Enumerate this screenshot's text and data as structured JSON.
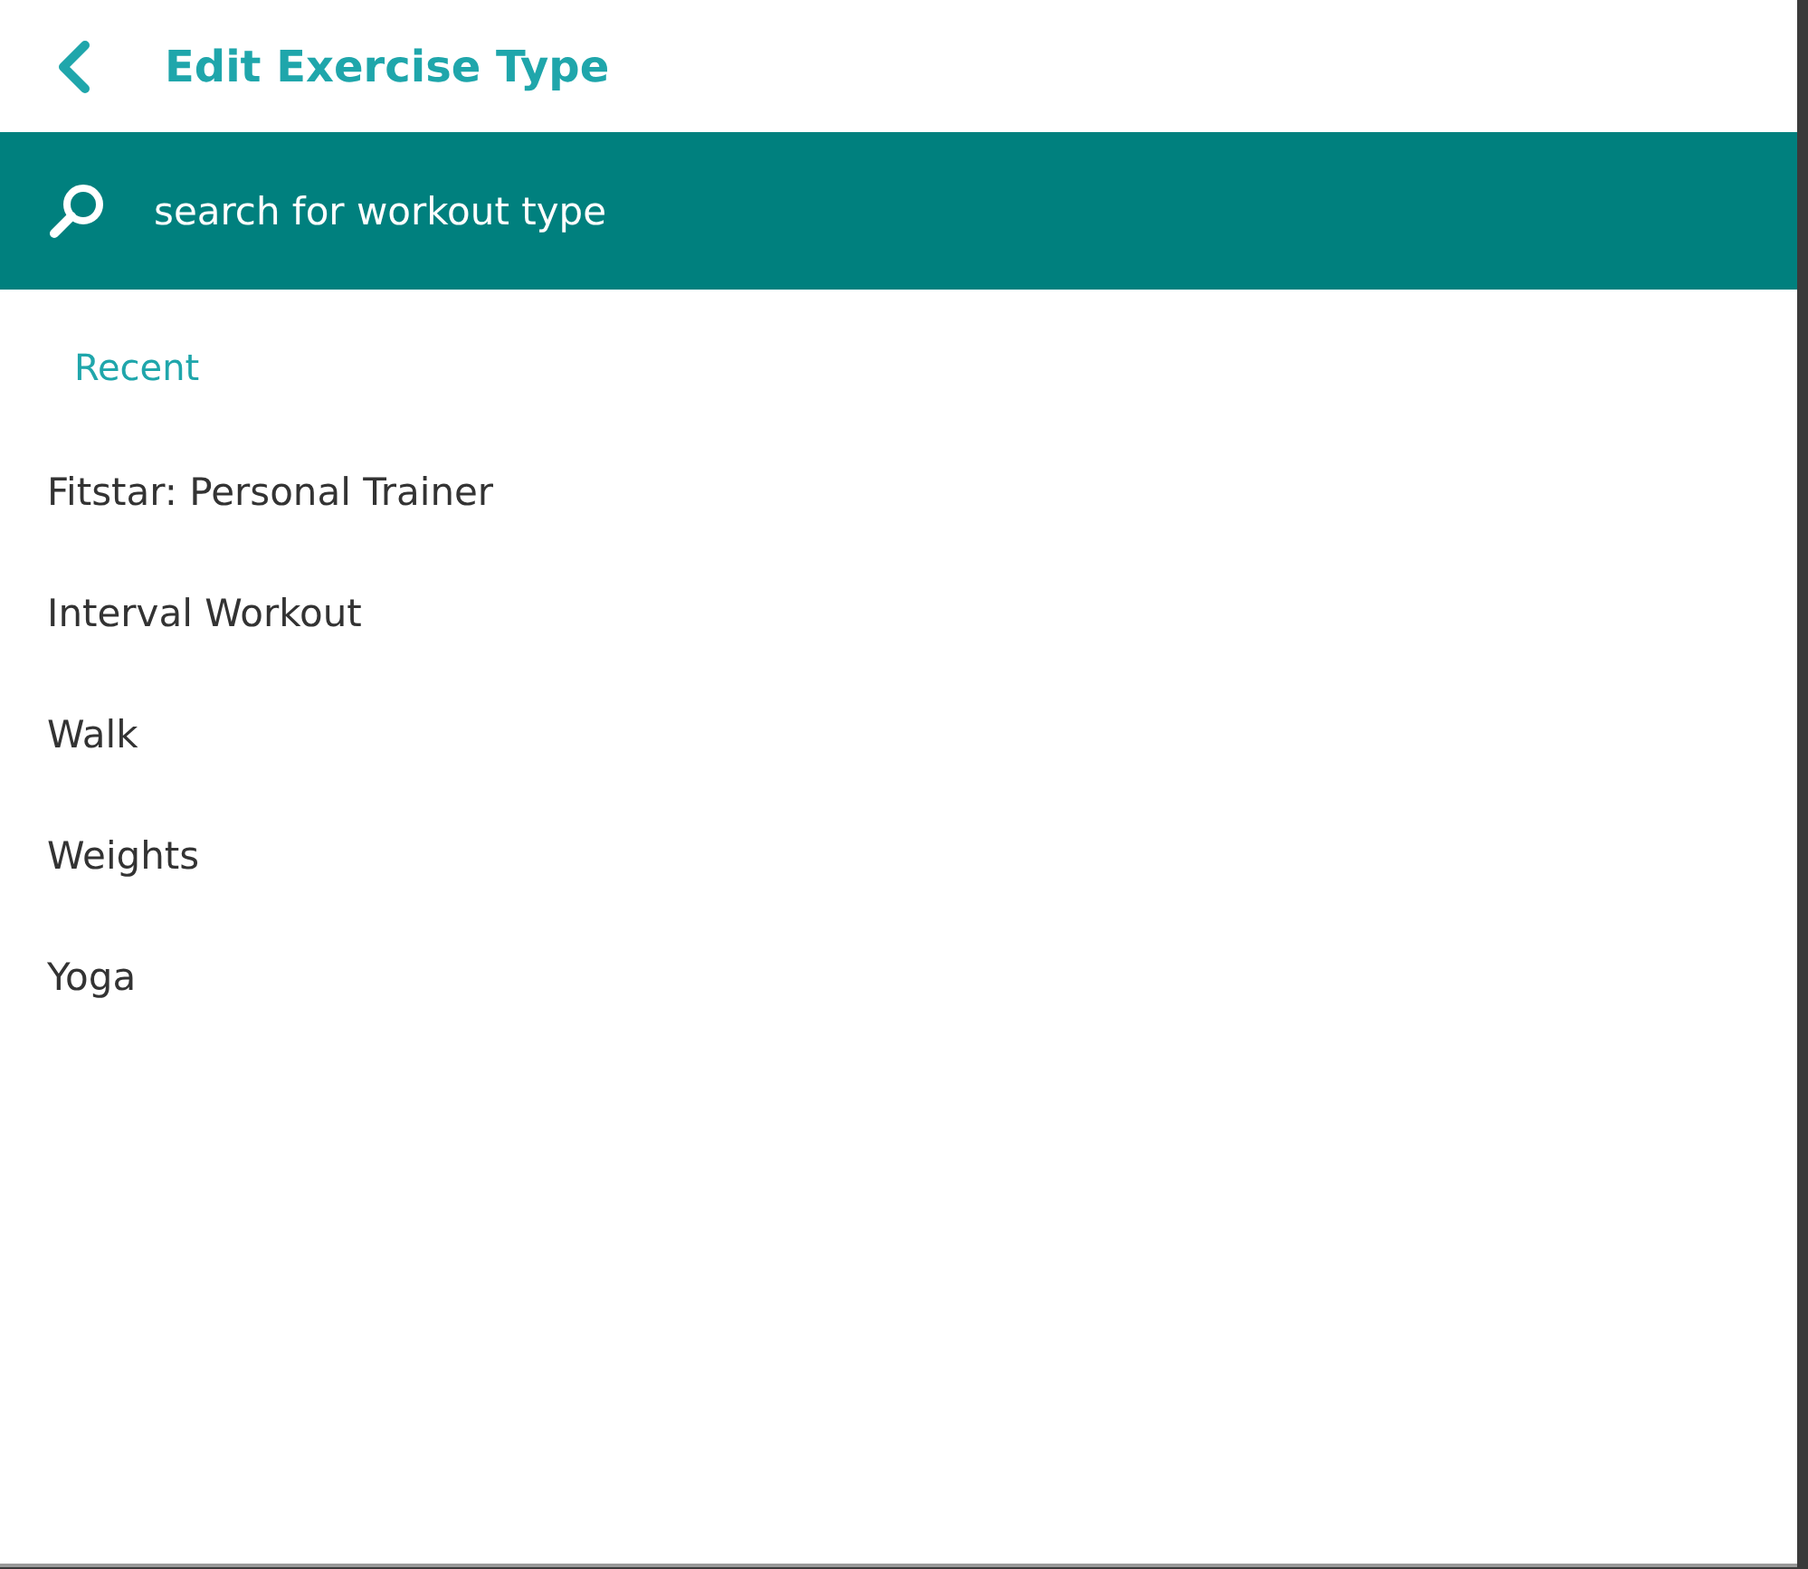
{
  "header": {
    "title": "Edit Exercise Type"
  },
  "search": {
    "placeholder": "search for workout type"
  },
  "section": {
    "title": "Recent"
  },
  "items": [
    {
      "label": "Fitstar: Personal Trainer"
    },
    {
      "label": "Interval Workout"
    },
    {
      "label": "Walk"
    },
    {
      "label": "Weights"
    },
    {
      "label": "Yoga"
    }
  ]
}
